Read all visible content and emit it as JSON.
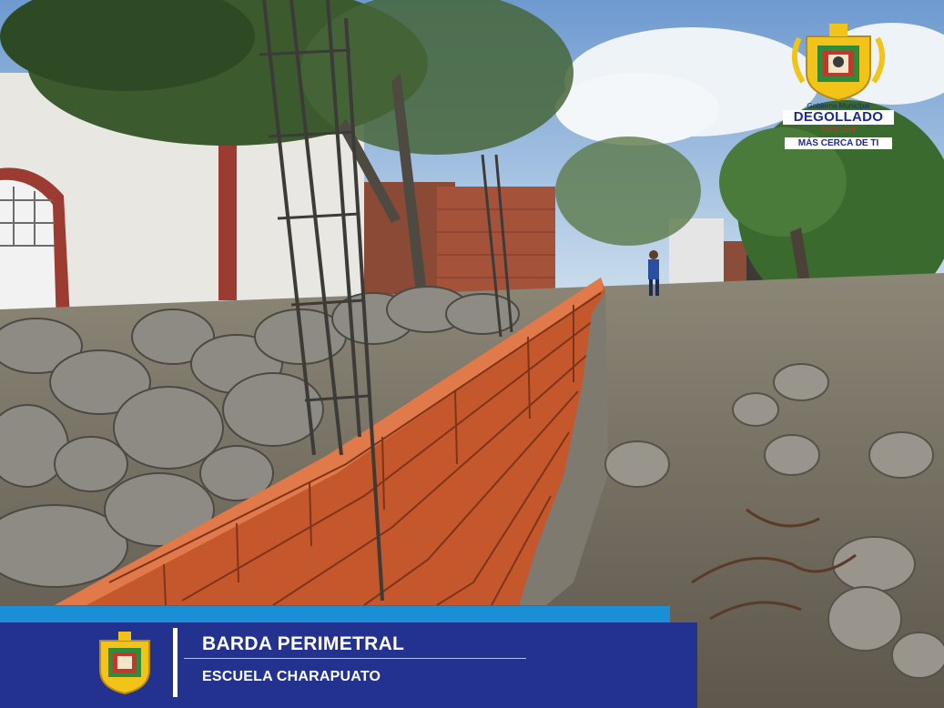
{
  "logo": {
    "gov": "Gobierno Municipal",
    "name": "DEGOLLADO",
    "years": "2015-2018",
    "tagline": "MÁS CERCA DE TI"
  },
  "banner": {
    "title": "BARDA PERIMETRAL",
    "subtitle": "ESCUELA CHARAPUATO"
  },
  "colors": {
    "banner_blue": "#23328f",
    "banner_stripe": "#1a8fd6",
    "brick": "#c5572c"
  }
}
